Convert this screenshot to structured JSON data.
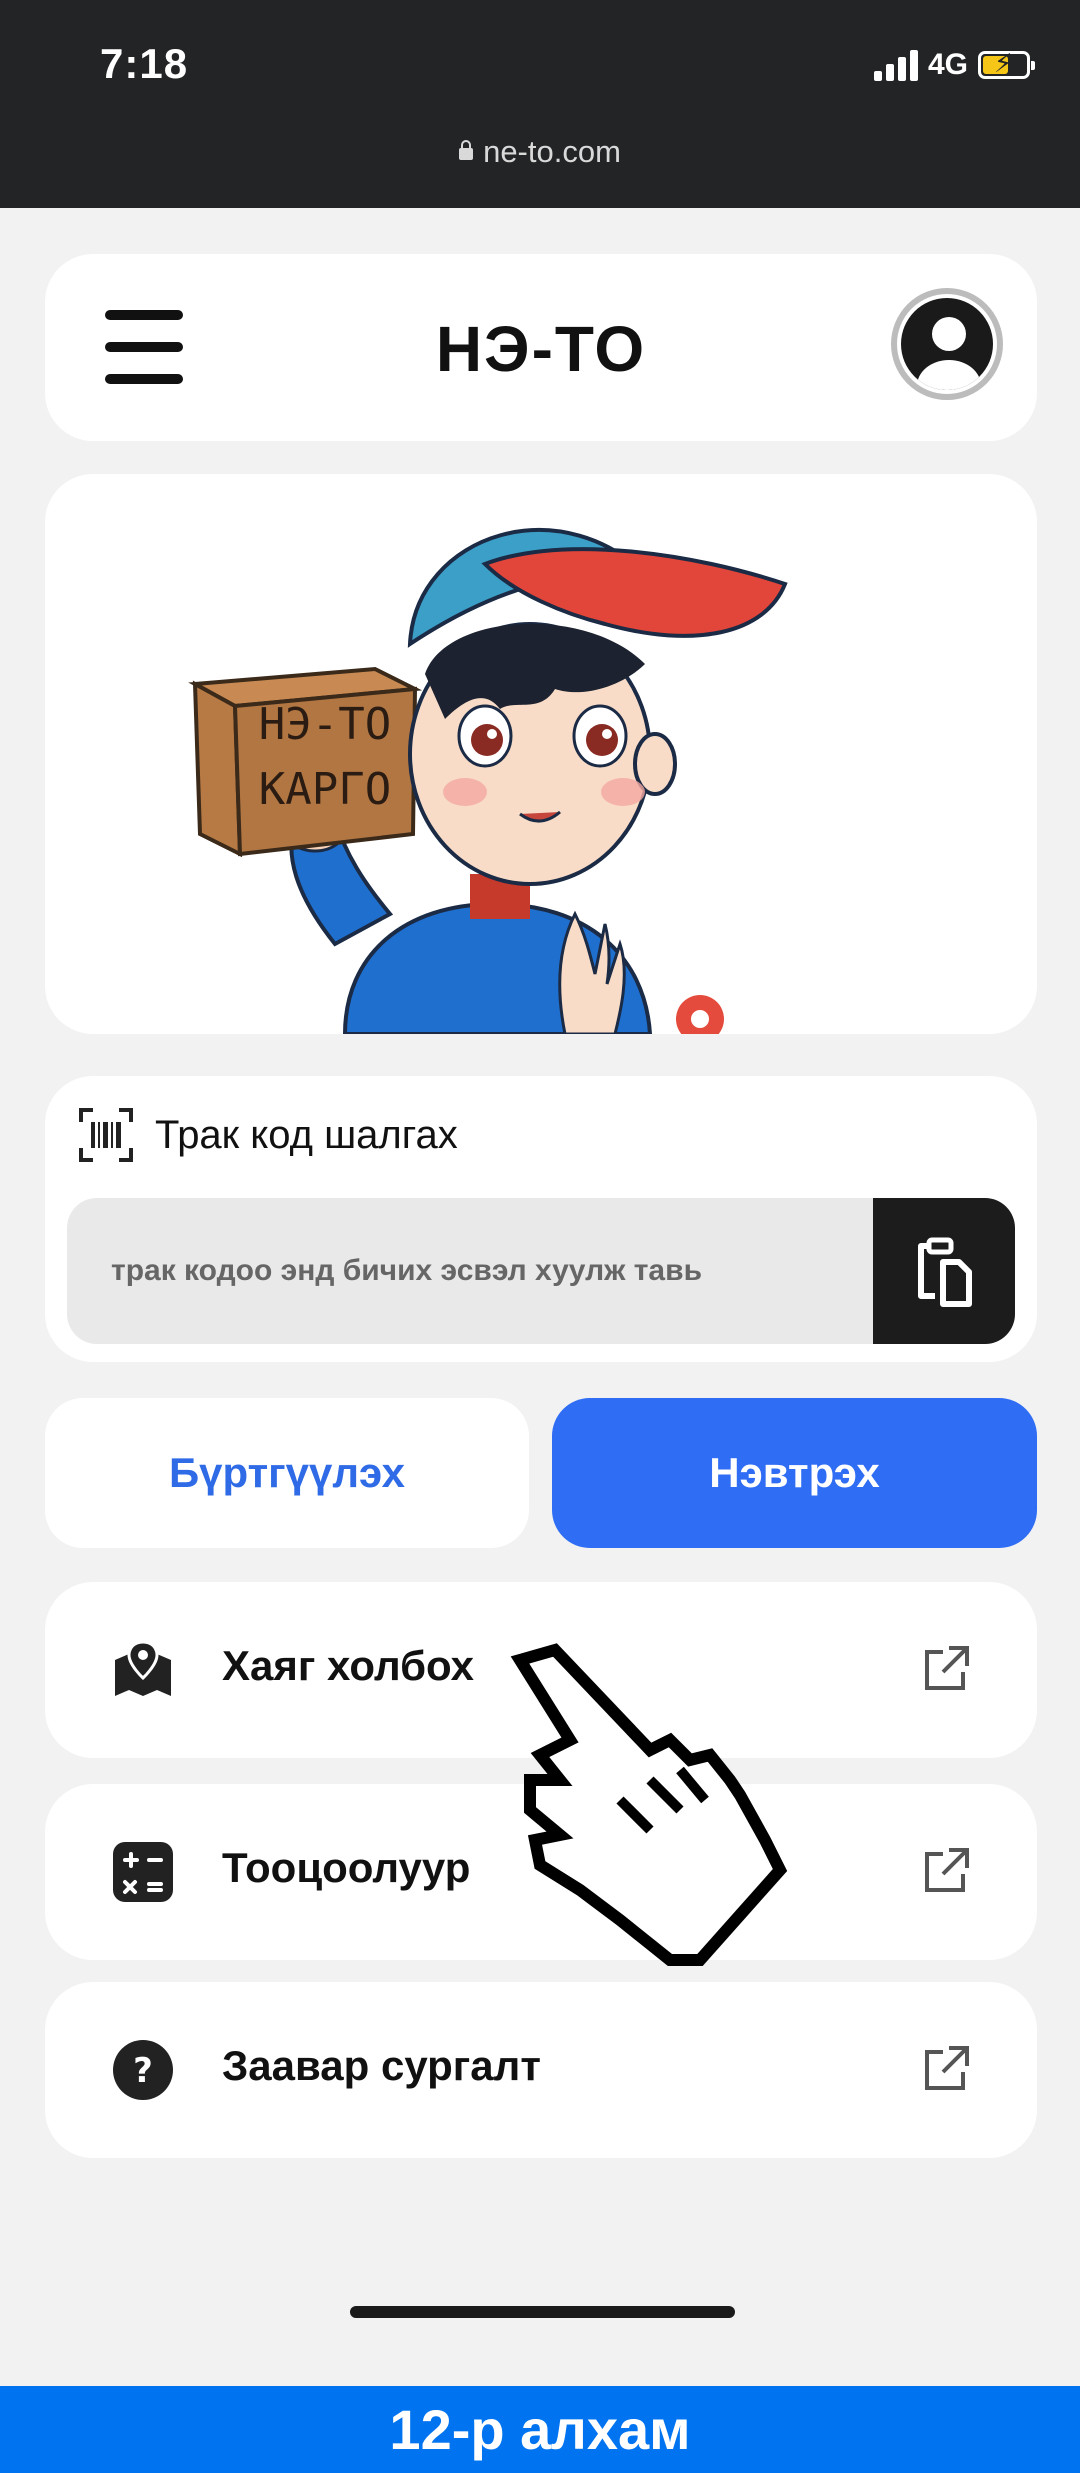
{
  "status": {
    "time": "7:18",
    "network": "4G",
    "battery_percent": 60,
    "battery_color": "#f5c518"
  },
  "browser": {
    "url": "ne-to.com"
  },
  "header": {
    "title": "НЭ-ТО",
    "menu_icon": "hamburger-icon",
    "account_icon": "user-avatar-icon"
  },
  "hero": {
    "box_line1": "НЭ-ТО",
    "box_line2": "КАРГО"
  },
  "track": {
    "title": "Трак код шалгах",
    "placeholder": "трак кодоо энд бичих эсвэл хуулж тавь",
    "title_icon": "barcode-scan-icon",
    "paste_icon": "paste-icon"
  },
  "auth": {
    "register_label": "Бүртгүүлэх",
    "login_label": "Нэвтрэх",
    "accent": "#2f6df5"
  },
  "menu": [
    {
      "label": "Хаяг холбох",
      "icon": "map-pin-icon"
    },
    {
      "label": "Тооцоолуур",
      "icon": "calculator-icon"
    },
    {
      "label": "Заавар сургалт",
      "icon": "help-icon"
    }
  ],
  "footer": {
    "step_label": "12-р алхам",
    "color": "#0074f0"
  }
}
